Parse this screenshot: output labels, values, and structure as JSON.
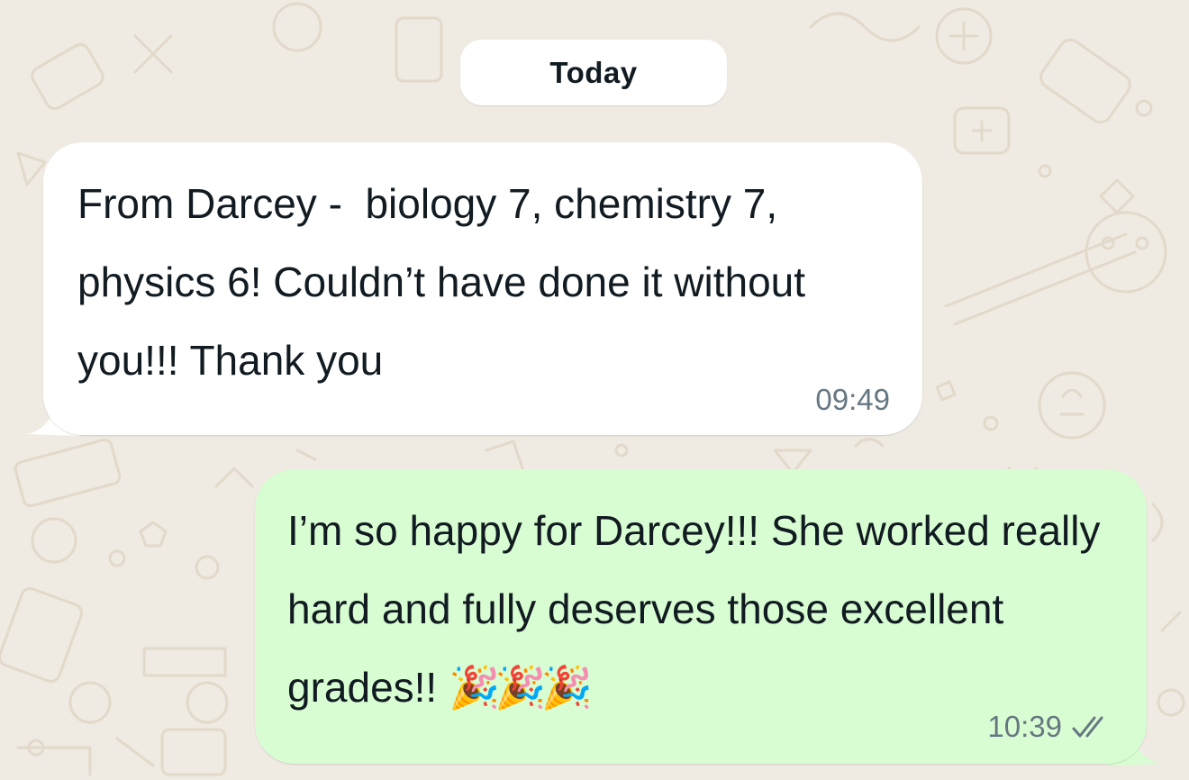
{
  "chat": {
    "date_divider": "Today",
    "messages": [
      {
        "direction": "incoming",
        "text": "From Darcey -  biology 7, chemistry 7, physics 6! Couldn’t have done it without you!!! Thank you",
        "time": "09:49"
      },
      {
        "direction": "outgoing",
        "text": "I’m so happy for Darcey!!! She worked really hard and fully deserves those excellent grades!!",
        "emojis": "🎉🎉🎉",
        "time": "10:39",
        "status_icon": "double-check-icon",
        "status": "read"
      }
    ]
  },
  "colors": {
    "background": "#efeae2",
    "incoming_bubble": "#ffffff",
    "outgoing_bubble": "#d9fdd3",
    "meta_text": "#667781",
    "pattern": "#e0d6c6"
  }
}
